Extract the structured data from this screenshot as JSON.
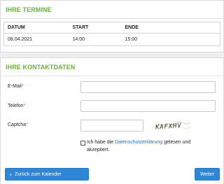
{
  "appointments": {
    "title": "IHRE TERMINE",
    "columns": [
      "DATUM",
      "START",
      "ENDE"
    ],
    "rows": [
      [
        "08.04.2021",
        "14:00",
        "15:00"
      ]
    ]
  },
  "contact": {
    "title": "IHRE KONTAKTDATEN",
    "email_label": "E-Mail",
    "phone_label": "Telefon",
    "captcha_label": "Captcha",
    "required_marker": "*",
    "email_value": "",
    "phone_value": "",
    "captcha_value": "",
    "captcha_text": "KAFXHV",
    "consent_prefix": "Ich habe die ",
    "consent_link": "Datenschutzerklärung",
    "consent_suffix": " gelesen und akzeptiert."
  },
  "footer": {
    "back_label": "Zurück zum Kalender",
    "next_label": "Weiter"
  },
  "colors": {
    "title_green": "#6ab03b",
    "button_blue": "#2f86d4",
    "link_blue": "#2b73c0",
    "required_red": "#d9534f"
  },
  "icons": {
    "back": "chevron-left-icon"
  }
}
